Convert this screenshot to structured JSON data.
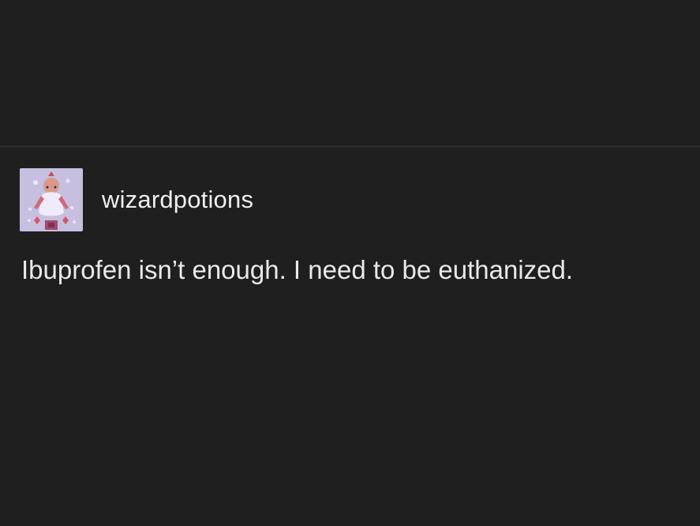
{
  "colors": {
    "background": "#1f1f20",
    "text": "#e9e9ea",
    "divider": "#2b2b2d",
    "avatar_bg": "#b9b3d6"
  },
  "post": {
    "avatar_icon": "avatar-image",
    "username": "wizardpotions",
    "text": "Ibuprofen isn’t enough. I need to be euthanized."
  }
}
